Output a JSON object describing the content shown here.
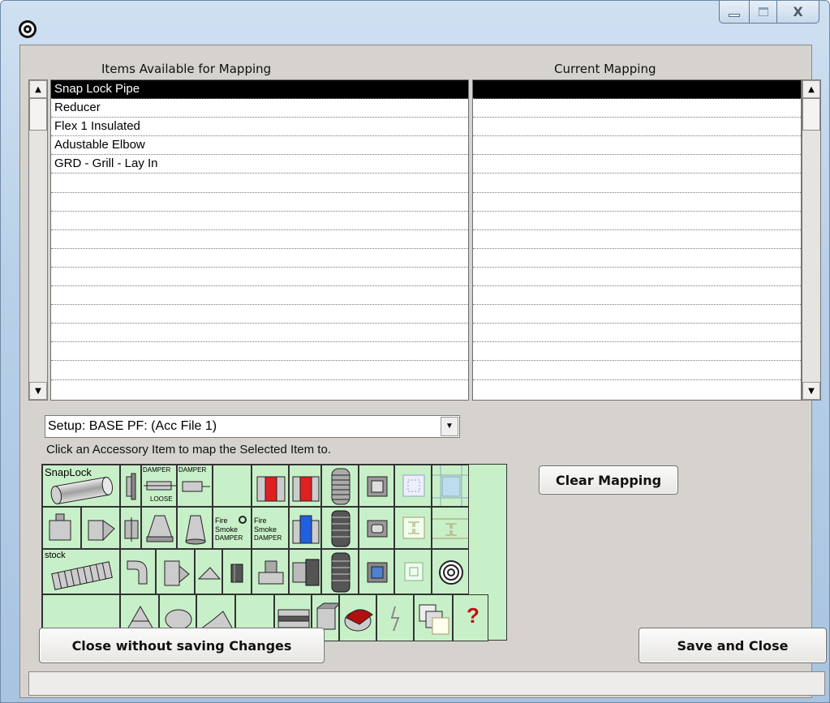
{
  "window": {
    "title": "",
    "close_glyph": "X"
  },
  "left_panel": {
    "header": "Items Available for Mapping",
    "items": [
      "Snap Lock Pipe",
      "Reducer",
      "Flex 1 Insulated",
      "Adustable Elbow",
      "GRD - Grill - Lay In",
      "",
      "",
      "",
      "",
      "",
      "",
      "",
      "",
      "",
      "",
      ""
    ],
    "selected_index": 0
  },
  "right_panel": {
    "header": "Current Mapping",
    "rows": [
      "",
      "",
      "",
      "",
      "",
      "",
      "",
      "",
      "",
      "",
      "",
      "",
      "",
      "",
      "",
      ""
    ],
    "selected_index": 0
  },
  "setup": {
    "selected": "Setup: BASE  PF: (Acc File 1)"
  },
  "instruction": "Click an Accessory Item to map the Selected Item to.",
  "palette": {
    "snaplock_label": "SnapLock",
    "stock_label": "stock",
    "damper_label_1": "DAMPER",
    "damper_label_2": "DAMPER",
    "loose_label": "LOOSE",
    "fire_smoke_1": [
      "Fire",
      "Smoke",
      "DAMPER"
    ],
    "fire_smoke_2": [
      "Fire",
      "Smoke",
      "DAMPER"
    ],
    "question_mark": "?",
    "colors": {
      "green": "#c8f0c8",
      "red": "#e02020",
      "blue": "#2060e0",
      "dark_red": "#b01010"
    }
  },
  "buttons": {
    "clear_mapping": "Clear Mapping",
    "close_without_saving": "Close without saving Changes",
    "save_and_close": "Save and Close"
  },
  "status": {
    "text": ""
  }
}
